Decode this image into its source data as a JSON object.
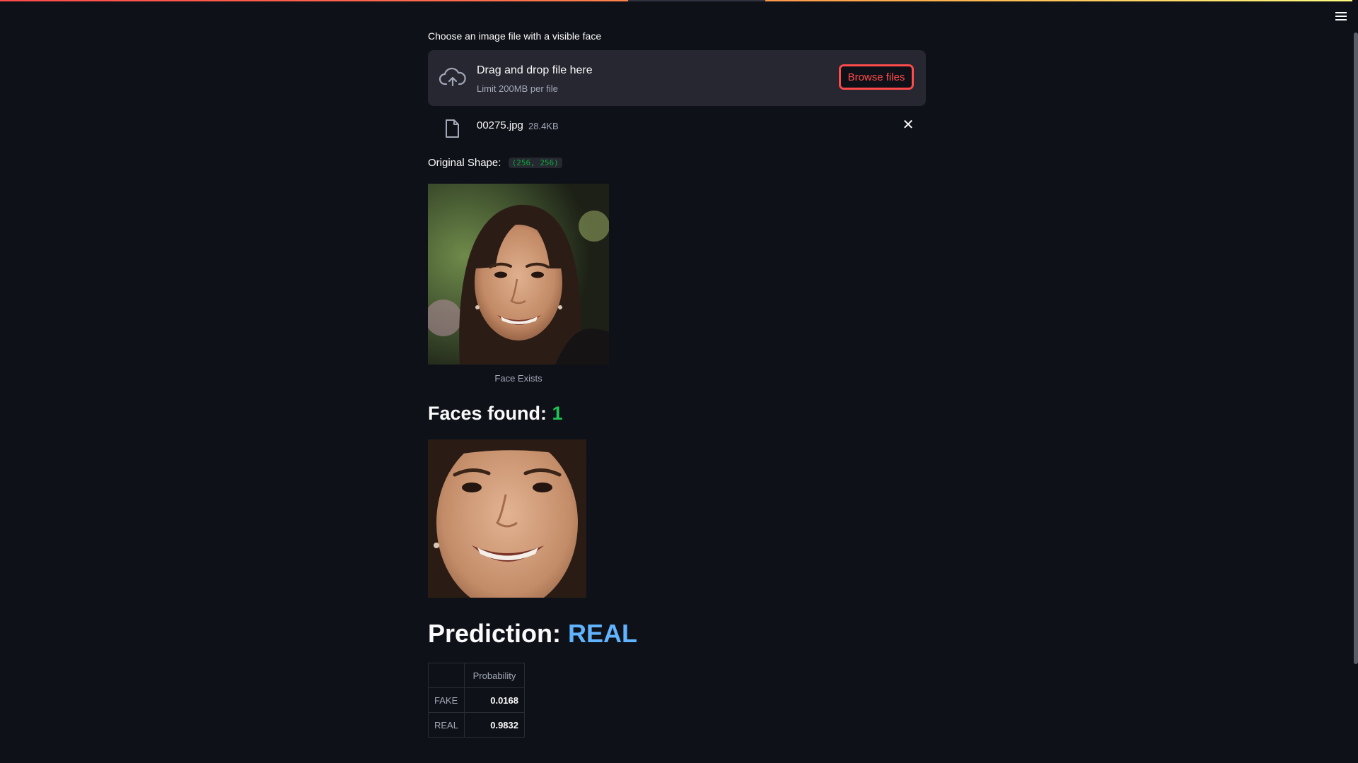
{
  "app": {
    "menu_icon": "hamburger-menu-icon"
  },
  "uploader": {
    "label": "Choose an image file with a visible face",
    "icon": "cloud-upload-icon",
    "drop_text": "Drag and drop file here",
    "limit_text": "Limit 200MB per file",
    "browse_label": "Browse files"
  },
  "file": {
    "icon": "file-icon",
    "name": "00275.jpg",
    "size": "28.4KB",
    "remove_icon": "close-icon"
  },
  "original_shape": {
    "label": "Original Shape:",
    "value": "(256, 256)"
  },
  "image_caption": "Face Exists",
  "faces": {
    "label": "Faces found:",
    "count": "1"
  },
  "prediction": {
    "label": "Prediction:",
    "value": "REAL"
  },
  "probability_table": {
    "header": "Probability",
    "rows": [
      {
        "label": "FAKE",
        "value": "0.0168"
      },
      {
        "label": "REAL",
        "value": "0.9832"
      }
    ]
  },
  "colors": {
    "background": "#0e1117",
    "accent": "#ff4b4b",
    "success": "#21c354",
    "prediction": "#60b4ff"
  }
}
